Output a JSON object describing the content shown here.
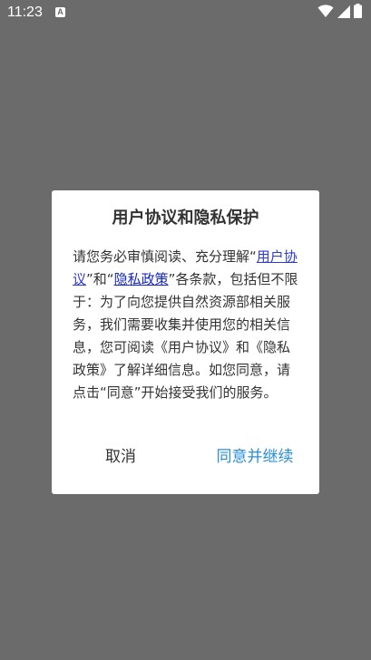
{
  "status_bar": {
    "time": "11:23",
    "notification_icon_letter": "A",
    "icons": [
      "wifi-icon",
      "cellular-signal-icon",
      "battery-icon"
    ]
  },
  "dialog": {
    "title": "用户协议和隐私保护",
    "body": {
      "text_1": "请您务必审慎阅读、充分理解“",
      "link_user_agreement": "用户协议",
      "text_2": "”和“",
      "link_privacy_policy": "隐私政策",
      "text_3": "”各条款，包括但不限于：为了向您提供自然资源部相关服务，我们需要收集并使用您的相关信息，您可阅读《用户协议》和《隐私政策》了解详细信息。如您同意，请点击“同意”开始接受我们的服务。"
    },
    "cancel_label": "取消",
    "agree_label": "同意并继续"
  },
  "colors": {
    "overlay_background": "#6b6b6b",
    "dialog_background": "#ffffff",
    "agree_button": "#2a8fd8",
    "link": "#2d3bd6"
  }
}
